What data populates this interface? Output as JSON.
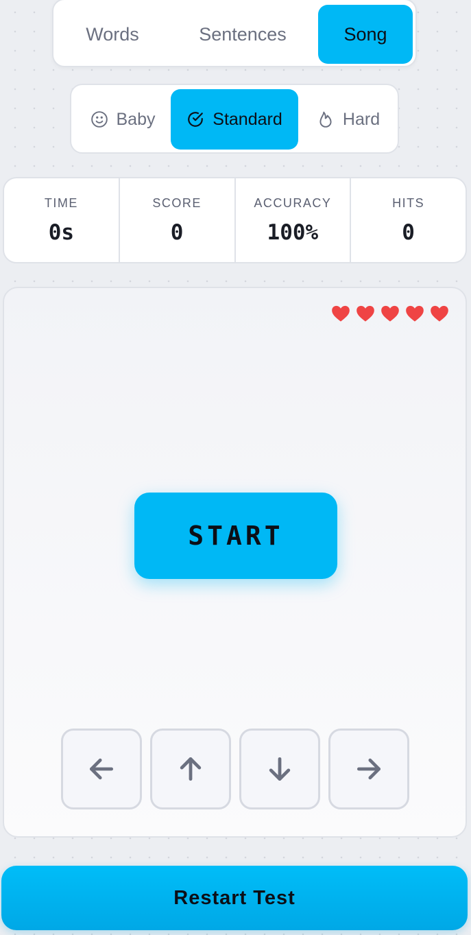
{
  "modes": {
    "words": "Words",
    "sentences": "Sentences",
    "song": "Song",
    "selected": "Song"
  },
  "difficulty": {
    "baby": "Baby",
    "standard": "Standard",
    "hard": "Hard",
    "selected": "Standard",
    "icons": {
      "baby": "smiley-icon",
      "standard": "check-circle-icon",
      "hard": "flame-icon"
    }
  },
  "stats": {
    "time": {
      "label": "TIME",
      "value": "0s"
    },
    "score": {
      "label": "SCORE",
      "value": "0"
    },
    "accuracy": {
      "label": "ACCURACY",
      "value": "100%"
    },
    "hits": {
      "label": "HITS",
      "value": "0"
    }
  },
  "game": {
    "lives": 5,
    "heart_color": "#ef4444",
    "start_label": "START",
    "arrow_keys": [
      "arrow-left-icon",
      "arrow-up-icon",
      "arrow-down-icon",
      "arrow-right-icon"
    ]
  },
  "restart_label": "Restart Test",
  "colors": {
    "accent": "#00b8f5",
    "text_muted": "#6b7080",
    "text_dark": "#1a1d26"
  }
}
